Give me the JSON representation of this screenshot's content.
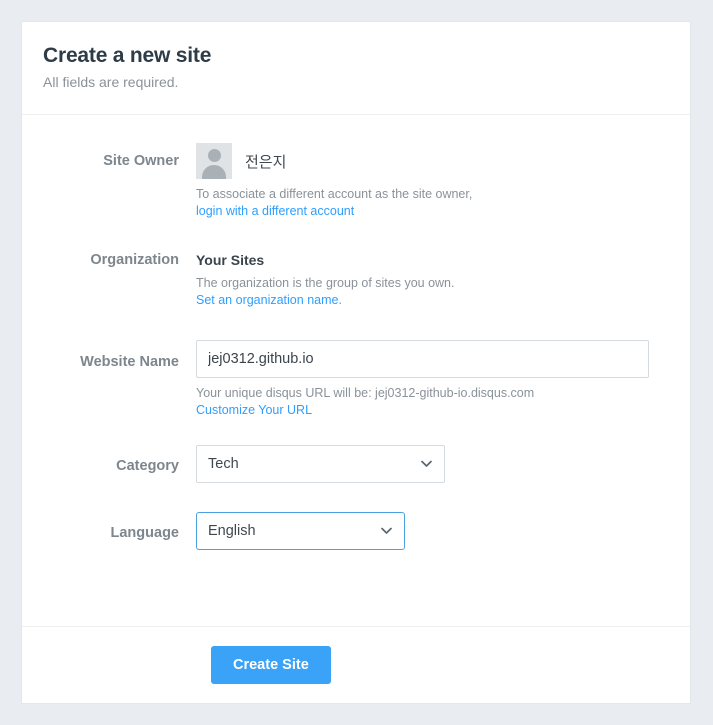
{
  "header": {
    "title": "Create a new site",
    "subtitle": "All fields are required."
  },
  "form": {
    "site_owner": {
      "label": "Site Owner",
      "avatar_icon": "user-avatar-placeholder-icon",
      "owner_name": "전은지",
      "help_text": "To associate a different account as the site owner,",
      "link_text": "login with a different account"
    },
    "organization": {
      "label": "Organization",
      "value": "Your Sites",
      "help_text": "The organization is the group of sites you own.",
      "link_text": "Set an organization name."
    },
    "website_name": {
      "label": "Website Name",
      "value": "jej0312.github.io",
      "placeholder": "",
      "help_text": "Your unique disqus URL will be: jej0312-github-io.disqus.com",
      "link_text": "Customize Your URL"
    },
    "category": {
      "label": "Category",
      "selected": "Tech",
      "chevron_icon": "chevron-down-icon"
    },
    "language": {
      "label": "Language",
      "selected": "English",
      "chevron_icon": "chevron-down-icon"
    }
  },
  "footer": {
    "submit_label": "Create Site"
  },
  "colors": {
    "page_background": "#e9edf2",
    "card_background": "#ffffff",
    "accent_blue": "#3aa2f7",
    "link_blue": "#2e9fff",
    "focus_border": "#4aa3e0",
    "label_gray": "#7d868d",
    "title_dark": "#2e3c47"
  }
}
